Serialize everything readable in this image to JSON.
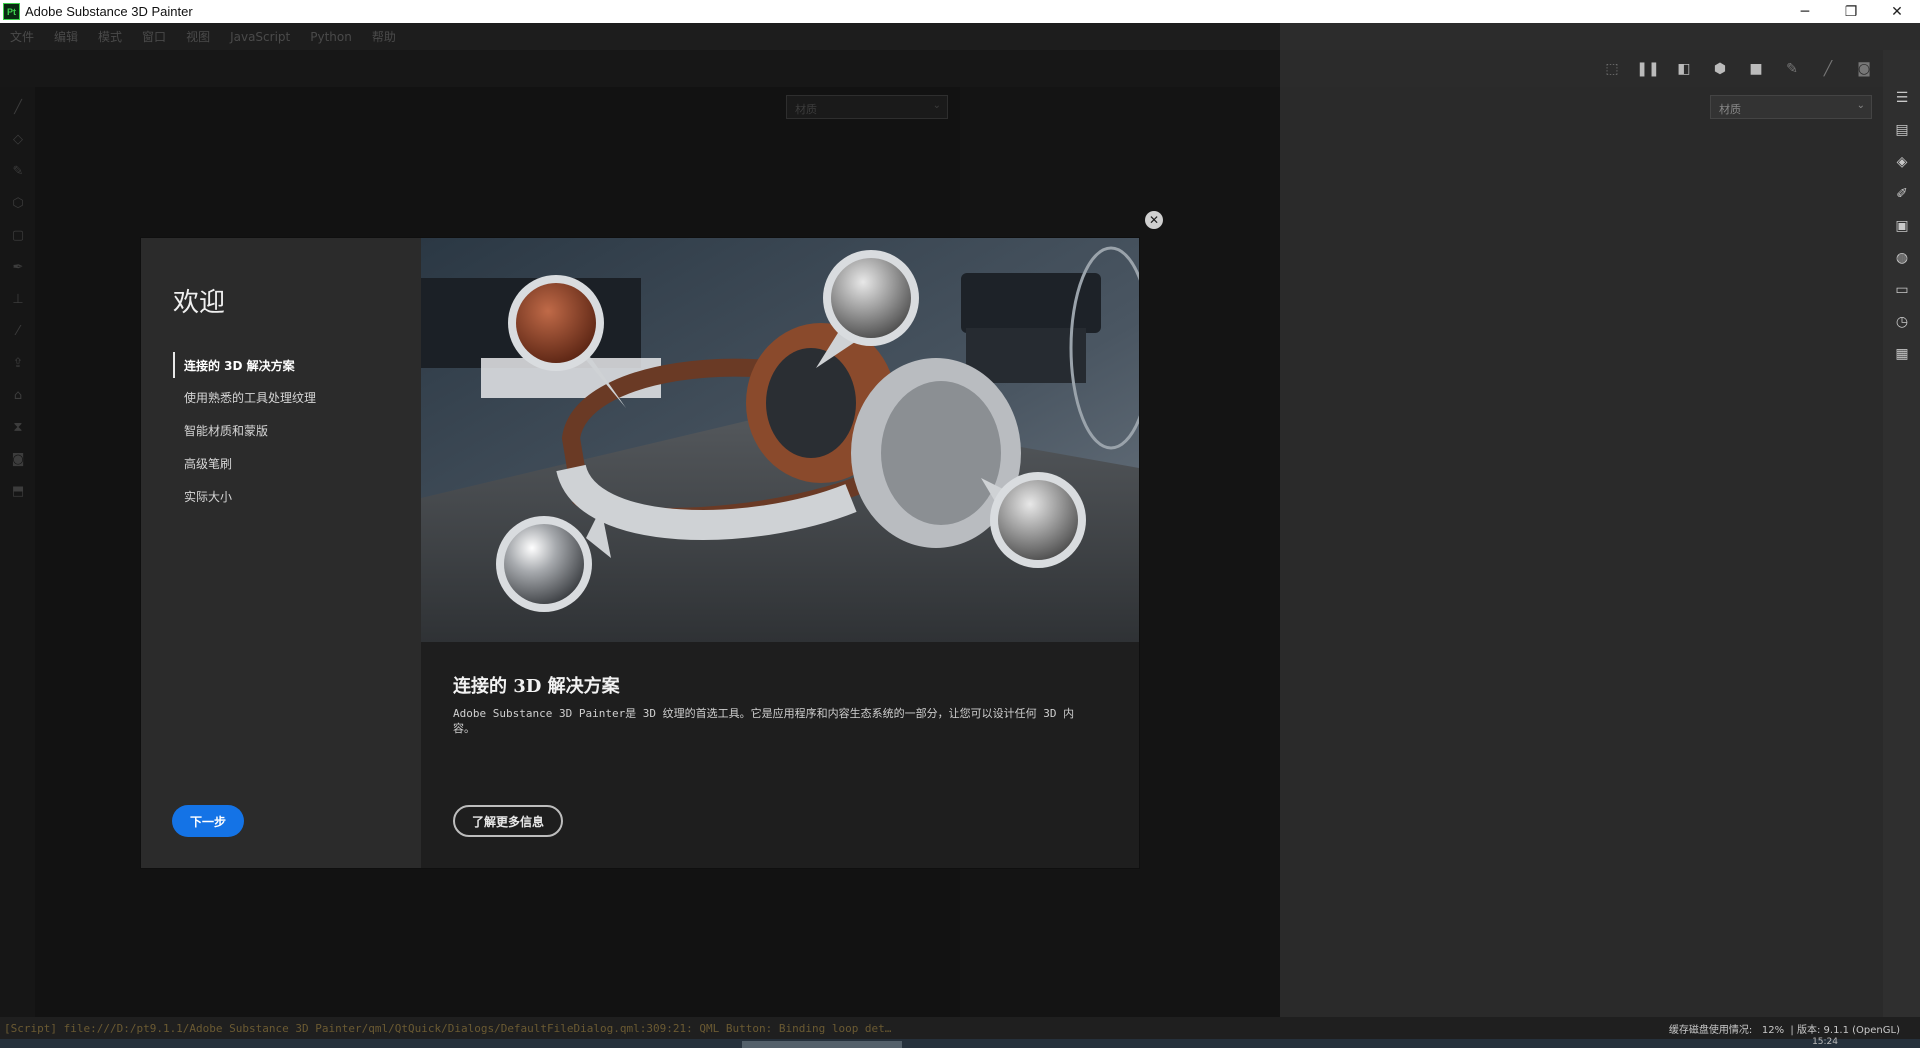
{
  "window": {
    "title": "Adobe Substance 3D Painter",
    "logo_text": "Pt",
    "minimize": "─",
    "restore": "❐",
    "close": "✕"
  },
  "menu": [
    "文件",
    "编辑",
    "模式",
    "窗口",
    "视图",
    "JavaScript",
    "Python",
    "帮助"
  ],
  "viewport": {
    "left_select": "材质",
    "right_select": "材质"
  },
  "welcome": {
    "heading": "欢迎",
    "nav": [
      "连接的 3D 解决方案",
      "使用熟悉的工具处理纹理",
      "智能材质和蒙版",
      "高级笔刷",
      "实际大小"
    ],
    "next_label": "下一步",
    "title": "连接的 3D 解决方案",
    "description": "Adobe Substance 3D Painter是 3D 纹理的首选工具。它是应用程序和内容生态系统的一部分，让您可以设计任何 3D 内容。",
    "learn_more_label": "了解更多信息",
    "close_glyph": "✕"
  },
  "status": {
    "log": "[Script] file:///D:/pt9.1.1/Adobe Substance 3D Painter/qml/QtQuick/Dialogs/DefaultFileDialog.qml:309:21: QML Button: Binding loop det…",
    "cache_label": "缓存磁盘使用情况:",
    "cache_value": "12%",
    "version": "版本: 9.1.1 (OpenGL)",
    "time": "15:24"
  },
  "icons": {
    "toolbar": [
      "dashed-frame-icon",
      "pause-icon",
      "split-view-icon",
      "cube-icon",
      "camera-icon",
      "brush-mask-icon",
      "brush-icon",
      "screenshot-icon"
    ],
    "right_dock": [
      "layers-panel-icon",
      "texture-set-icon",
      "stack-icon",
      "brush-properties-icon",
      "display-settings-icon",
      "globe-icon",
      "shelf-icon",
      "history-icon",
      "log-icon"
    ]
  },
  "colors": {
    "accent": "#1473e6"
  }
}
